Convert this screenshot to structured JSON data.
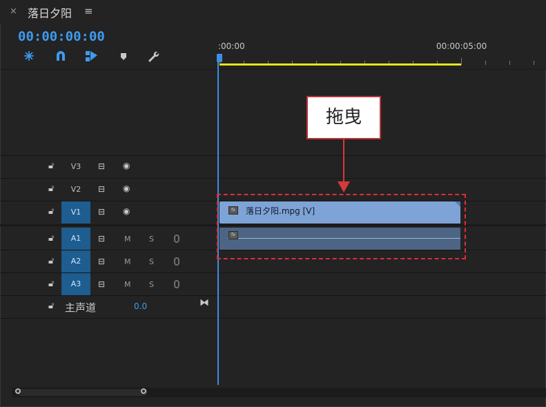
{
  "panel": {
    "close_glyph": "×",
    "title": "落日夕阳",
    "menu_glyph": "≡",
    "timecode": "00:00:00:00"
  },
  "toolbar": {
    "icons": [
      "nest-sequence-icon",
      "snap-magnet-icon",
      "linked-selection-icon",
      "add-marker-icon",
      "settings-wrench-icon"
    ]
  },
  "ruler": {
    "start_label": ":00:00",
    "mark_label": "00:00:05:00"
  },
  "tracks": {
    "video": [
      {
        "name": "V3",
        "selected": false
      },
      {
        "name": "V2",
        "selected": false
      },
      {
        "name": "V1",
        "selected": true
      }
    ],
    "audio": [
      {
        "name": "A1",
        "selected": true,
        "m": "M",
        "s": "S"
      },
      {
        "name": "A2",
        "selected": true,
        "m": "M",
        "s": "S"
      },
      {
        "name": "A3",
        "selected": true,
        "m": "M",
        "s": "S"
      }
    ],
    "master": {
      "label": "主声道",
      "value": "0.0"
    }
  },
  "clip": {
    "fx_label": "fx",
    "name": "落日夕阳.mpg [V]"
  },
  "callout": {
    "text": "拖曳"
  },
  "colors": {
    "accent": "#3d9bf0",
    "workbar": "#e6e619",
    "video_clip": "#7ea3d6",
    "audio_clip": "#4d6585",
    "callout_border": "#c0313a"
  }
}
